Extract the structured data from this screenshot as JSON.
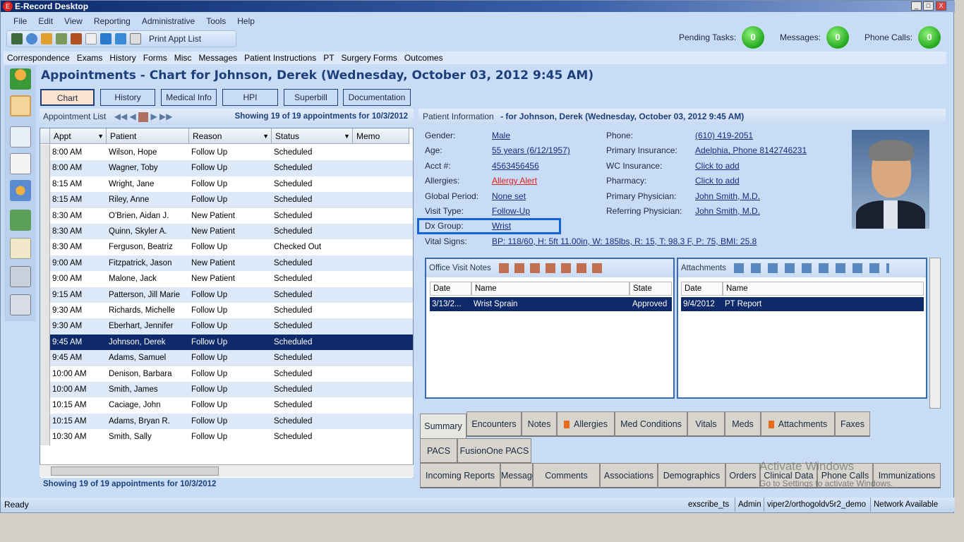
{
  "window": {
    "title": "E-Record Desktop",
    "controls": [
      "_",
      "□",
      "X"
    ]
  },
  "menu": [
    "File",
    "Edit",
    "View",
    "Reporting",
    "Administrative",
    "Tools",
    "Help"
  ],
  "toolbar": {
    "print_label": "Print Appt List"
  },
  "counters": [
    {
      "label": "Pending Tasks:",
      "value": "0"
    },
    {
      "label": "Messages:",
      "value": "0"
    },
    {
      "label": "Phone Calls:",
      "value": "0"
    }
  ],
  "menu2": [
    "Correspondence",
    "Exams",
    "History",
    "Forms",
    "Misc",
    "Messages",
    "Patient Instructions",
    "PT",
    "Surgery Forms",
    "Outcomes"
  ],
  "page_title": "Appointments - Chart for Johnson, Derek (Wednesday, October 03, 2012 9:45 AM)",
  "nav_buttons": [
    "Chart",
    "History",
    "Medical Info",
    "HPI",
    "Superbill",
    "Documentation"
  ],
  "active_nav": "Chart",
  "appt_list": {
    "label": "Appointment List",
    "summary": "Showing 19 of 19 appointments for 10/3/2012",
    "footer": "Showing 19 of 19 appointments for 10/3/2012",
    "columns": [
      "Appt",
      "Patient",
      "Reason",
      "Status",
      "Memo"
    ],
    "rows": [
      [
        "8:00 AM",
        "Wilson, Hope",
        "Follow Up",
        "Scheduled"
      ],
      [
        "8:00 AM",
        "Wagner, Toby",
        "Follow Up",
        "Scheduled"
      ],
      [
        "8:15 AM",
        "Wright, Jane",
        "Follow Up",
        "Scheduled"
      ],
      [
        "8:15 AM",
        "Riley, Anne",
        "Follow Up",
        "Scheduled"
      ],
      [
        "8:30 AM",
        "O'Brien, Aidan J.",
        "New Patient",
        "Scheduled"
      ],
      [
        "8:30 AM",
        "Quinn, Skyler A.",
        "New Patient",
        "Scheduled"
      ],
      [
        "8:30 AM",
        "Ferguson, Beatriz",
        "Follow Up",
        "Checked Out"
      ],
      [
        "9:00 AM",
        "Fitzpatrick, Jason",
        "New Patient",
        "Scheduled"
      ],
      [
        "9:00 AM",
        "Malone, Jack",
        "New Patient",
        "Scheduled"
      ],
      [
        "9:15 AM",
        "Patterson, Jill Marie",
        "Follow Up",
        "Scheduled"
      ],
      [
        "9:30 AM",
        "Richards, Michelle",
        "Follow Up",
        "Scheduled"
      ],
      [
        "9:30 AM",
        "Eberhart, Jennifer",
        "Follow Up",
        "Scheduled"
      ],
      [
        "9:45 AM",
        "Johnson, Derek",
        "Follow Up",
        "Scheduled"
      ],
      [
        "9:45 AM",
        "Adams, Samuel",
        "Follow Up",
        "Scheduled"
      ],
      [
        "10:00 AM",
        "Denison, Barbara",
        "Follow Up",
        "Scheduled"
      ],
      [
        "10:00 AM",
        "Smith, James",
        "Follow Up",
        "Scheduled"
      ],
      [
        "10:15 AM",
        "Caciage, John",
        "Follow Up",
        "Scheduled"
      ],
      [
        "10:15 AM",
        "Adams, Bryan R.",
        "Follow Up",
        "Scheduled"
      ],
      [
        "10:30 AM",
        "Smith, Sally",
        "Follow Up",
        "Scheduled"
      ]
    ],
    "selected_index": 12
  },
  "patient_info": {
    "header_label": "Patient Information",
    "header_for": "- for Johnson, Derek (Wednesday, October 03, 2012 9:45 AM)",
    "left": [
      {
        "label": "Gender:",
        "value": "Male"
      },
      {
        "label": "Age:",
        "value": "55 years (6/12/1957)"
      },
      {
        "label": "Acct #:",
        "value": "4563456456"
      },
      {
        "label": "Allergies:",
        "value": "Allergy Alert",
        "alert": true
      },
      {
        "label": "Global Period:",
        "value": "None set"
      },
      {
        "label": "Visit Type:",
        "value": "Follow-Up"
      },
      {
        "label": "Dx Group:",
        "value": "Wrist"
      }
    ],
    "right": [
      {
        "label": "Phone:",
        "value": "(610) 419-2051"
      },
      {
        "label": "Primary Insurance:",
        "value": "Adelphia, Phone 8142746231"
      },
      {
        "label": "WC Insurance:",
        "value": "Click to add"
      },
      {
        "label": "Pharmacy:",
        "value": "Click to add"
      },
      {
        "label": "Primary Physician:",
        "value": "John Smith, M.D."
      },
      {
        "label": "Referring Physician:",
        "value": "John Smith, M.D."
      }
    ],
    "vitals": {
      "label": "Vital Signs:",
      "value": "BP: 118/60, H: 5ft 11.00in, W: 185lbs, R: 15, T: 98.3 F, P: 75, BMI: 25.8"
    }
  },
  "office_visit_notes": {
    "title": "Office Visit Notes",
    "columns": [
      "Date",
      "Name",
      "State"
    ],
    "rows": [
      [
        "3/13/2...",
        "Wrist Sprain",
        "Approved"
      ]
    ]
  },
  "attachments": {
    "title": "Attachments",
    "columns": [
      "Date",
      "Name"
    ],
    "rows": [
      [
        "9/4/2012",
        "PT Report"
      ]
    ]
  },
  "tabs_row1": [
    "Summary",
    "Encounters",
    "Notes",
    "Allergies",
    "Med Conditions",
    "Vitals",
    "Meds",
    "Attachments",
    "Faxes"
  ],
  "tabs_row2": [
    "PACS",
    "FusionOne PACS"
  ],
  "tabs_row3": [
    "Incoming Reports",
    "Messages",
    "Comments",
    "Associations",
    "Demographics",
    "Orders",
    "Clinical Data",
    "Phone Calls",
    "Immunizations"
  ],
  "watermark": {
    "line1": "Activate Windows",
    "line2": "Go to Settings to activate Windows."
  },
  "status": {
    "left": "Ready",
    "items": [
      "exscribe_ts",
      "Admin",
      "viper2/orthogoldv5r2_demo",
      "Network Available"
    ]
  },
  "colors": {
    "title_blue": "#1d3f7a",
    "selected_row": "#0f2a6a",
    "alert_red": "#e02020",
    "highlight_box": "#1464d8",
    "counter_green": "#22a81c"
  }
}
